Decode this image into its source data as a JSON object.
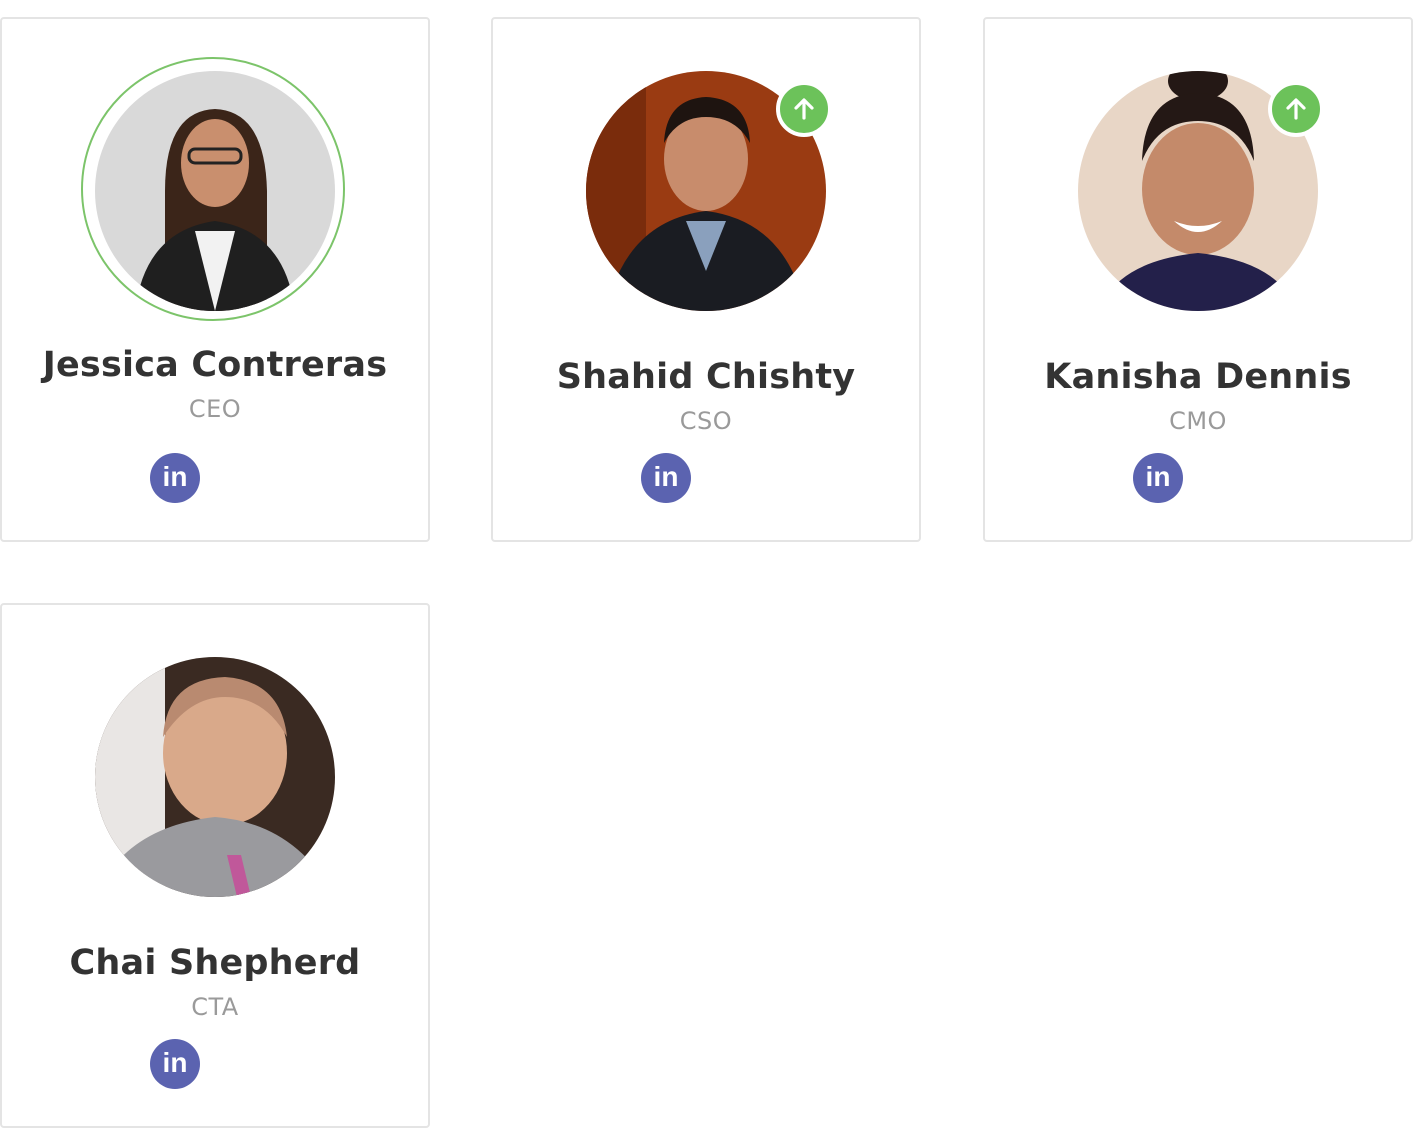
{
  "team": [
    {
      "name": "Jessica Contreras",
      "role": "CEO",
      "linkedin_label": "in",
      "ring_color": "#7cc46a",
      "avatar_palette": {
        "bg": "#d9d9d9",
        "skin": "#c98f6e",
        "hair": "#3b2519",
        "clothes": "#1f1f1f"
      }
    },
    {
      "name": "Shahid Chishty",
      "role": "CSO",
      "linkedin_label": "in",
      "badge_icon": "arrow-up-icon",
      "badge_color": "#6cc25a",
      "avatar_palette": {
        "bg": "#9a3b12",
        "skin": "#c88c6c",
        "hair": "#1e1410",
        "clothes": "#1a1c22"
      }
    },
    {
      "name": "Kanisha Dennis",
      "role": "CMO",
      "linkedin_label": "in",
      "badge_icon": "arrow-up-icon",
      "badge_color": "#6cc25a",
      "avatar_palette": {
        "bg": "#e8d6c6",
        "skin": "#c48a6a",
        "hair": "#241815",
        "clothes": "#23204a"
      }
    },
    {
      "name": "Chai Shepherd",
      "role": "CTA",
      "linkedin_label": "in",
      "avatar_palette": {
        "bg": "#3a2a22",
        "skin": "#d9a98a",
        "hair": "#b98a70",
        "clothes": "#9a9a9e"
      }
    }
  ],
  "colors": {
    "card_border": "#e4e4e4",
    "name_text": "#333333",
    "role_text": "#9a9a9a",
    "linkedin_bg": "#5b63b0"
  }
}
